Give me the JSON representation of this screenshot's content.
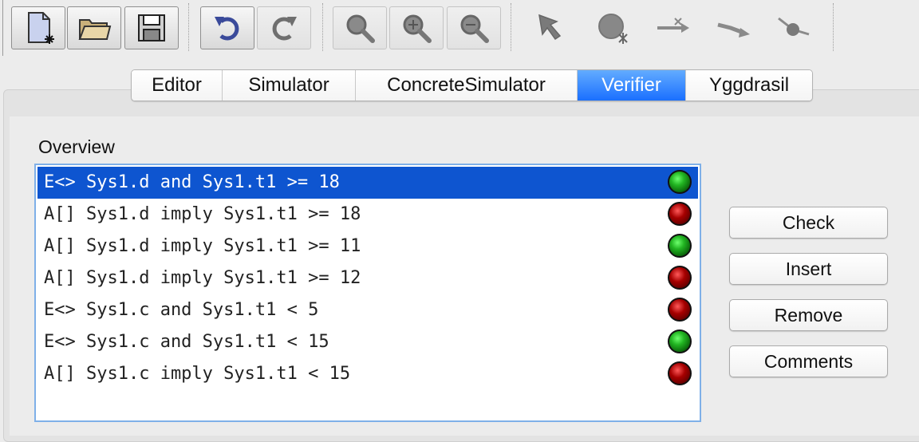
{
  "toolbar": {
    "buttons": [
      {
        "icon": "new-document-icon"
      },
      {
        "icon": "open-folder-icon"
      },
      {
        "icon": "save-icon"
      },
      {
        "icon": "undo-icon"
      },
      {
        "icon": "redo-icon"
      },
      {
        "icon": "zoom-icon"
      },
      {
        "icon": "zoom-in-icon"
      },
      {
        "icon": "zoom-out-icon"
      },
      {
        "icon": "select-arrow-icon"
      },
      {
        "icon": "add-location-icon"
      },
      {
        "icon": "add-edge-icon"
      },
      {
        "icon": "add-nail-icon"
      },
      {
        "icon": "add-branchpoint-icon"
      }
    ]
  },
  "tabs": [
    "Editor",
    "Simulator",
    "ConcreteSimulator",
    "Verifier",
    "Yggdrasil"
  ],
  "active_tab": "Verifier",
  "overview": {
    "label": "Overview",
    "queries": [
      {
        "text": "E<> Sys1.d and Sys1.t1 >= 18",
        "status": "green",
        "selected": true
      },
      {
        "text": "A[] Sys1.d imply Sys1.t1 >= 18",
        "status": "red"
      },
      {
        "text": "A[] Sys1.d imply Sys1.t1 >= 11",
        "status": "green"
      },
      {
        "text": "A[] Sys1.d imply Sys1.t1 >= 12",
        "status": "red"
      },
      {
        "text": "E<> Sys1.c and Sys1.t1 < 5",
        "status": "red"
      },
      {
        "text": "E<> Sys1.c and Sys1.t1 < 15",
        "status": "green"
      },
      {
        "text": "A[] Sys1.c imply Sys1.t1 < 15",
        "status": "red"
      }
    ]
  },
  "actions": {
    "check": "Check",
    "insert": "Insert",
    "remove": "Remove",
    "comments": "Comments"
  },
  "colors": {
    "selection": "#0e55d0",
    "active_tab": "#1a6fff",
    "status_green": "#22b522",
    "status_red": "#a60000"
  }
}
